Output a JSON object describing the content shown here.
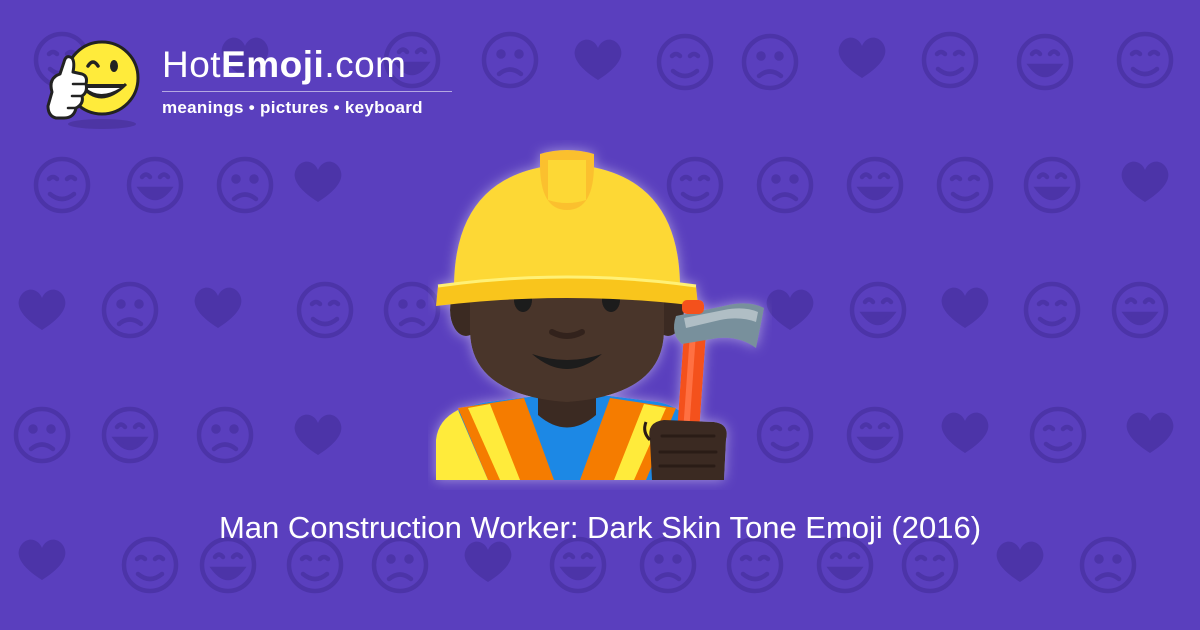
{
  "site": {
    "name_prefix": "Hot",
    "name_bold": "Emoji",
    "name_suffix": ".com",
    "tagline": "meanings • pictures • keyboard"
  },
  "emoji": {
    "caption": "Man Construction Worker: Dark Skin Tone Emoji (2016)",
    "icon": "man-construction-worker-dark-skin-tone-icon"
  },
  "colors": {
    "background": "#5a3fbe",
    "pattern": "#4c34a8",
    "text": "#ffffff",
    "helmet": "#fdd835",
    "vest_orange": "#f57c00",
    "vest_yellow": "#ffeb3b",
    "shirt": "#1e88e5",
    "skin": "#4a342a",
    "hammer_handle": "#f4511e",
    "hammer_head": "#78909c"
  }
}
